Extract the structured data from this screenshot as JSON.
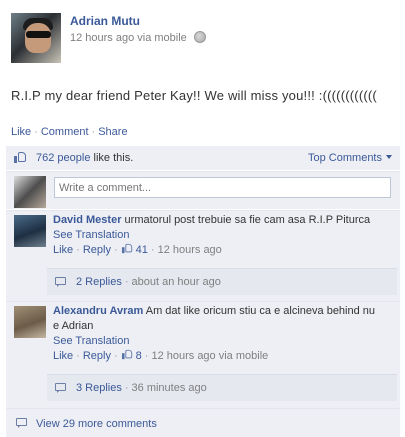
{
  "post": {
    "author": "Adrian Mutu",
    "time": "12 hours ago",
    "via": "via mobile",
    "text": "R.I.P my dear friend Peter Kay!! We will miss you!!! :(((((((((((("
  },
  "actions": {
    "like": "Like",
    "comment": "Comment",
    "share": "Share"
  },
  "likes": {
    "count": "762 people",
    "suffix": " like this.",
    "top_comments": "Top Comments"
  },
  "composer": {
    "placeholder": "Write a comment..."
  },
  "comments": [
    {
      "author": "David Mester",
      "text_line1": "urmatorul post trebuie sa fie cam asa R.I.P Piturca",
      "text_line2": "",
      "see_translation": "See Translation",
      "like": "Like",
      "reply": "Reply",
      "like_count": "41",
      "time": "12 hours ago",
      "via": "",
      "replies": "2 Replies",
      "replies_time": "about an hour ago"
    },
    {
      "author": "Alexandru Avram",
      "text_line1": "Am dat like oricum stiu ca e alcineva behind nu",
      "text_line2": "e Adrian",
      "see_translation": "See Translation",
      "like": "Like",
      "reply": "Reply",
      "like_count": "8",
      "time": "12 hours ago",
      "via": "via mobile",
      "replies": "3 Replies",
      "replies_time": "36 minutes ago"
    }
  ],
  "view_more": "View 29 more comments",
  "colors": {
    "link": "#3b5998",
    "panel": "#edeff4",
    "muted": "#7f7f7f"
  },
  "icons": [
    "globe-icon",
    "thumbs-up-icon",
    "chevron-down-icon",
    "speech-bubble-icon"
  ]
}
